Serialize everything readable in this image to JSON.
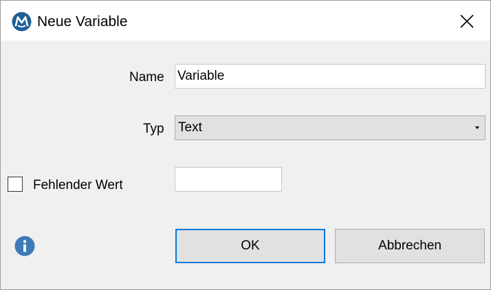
{
  "window": {
    "title": "Neue Variable",
    "logo_icon": "app-logo-icon",
    "close_icon": "close-icon"
  },
  "form": {
    "name_label": "Name",
    "name_value": "Variable",
    "type_label": "Typ",
    "type_selected": "Text",
    "missing_label": "Fehlender Wert",
    "missing_checked": false,
    "missing_value": ""
  },
  "footer": {
    "info_icon": "info-icon",
    "ok_label": "OK",
    "cancel_label": "Abbrechen"
  },
  "colors": {
    "accent": "#0078d7",
    "info": "#3d7ab8",
    "logo": "#1e5f96"
  }
}
